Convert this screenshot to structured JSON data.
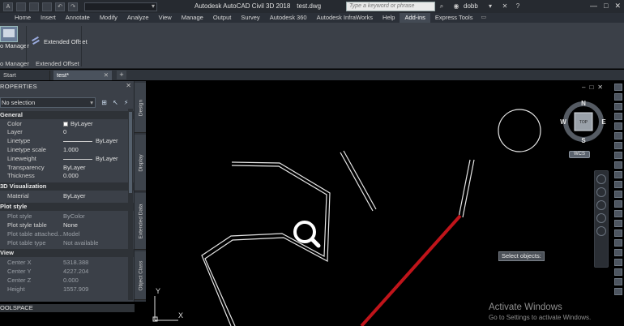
{
  "titlebar": {
    "app_title": "Autodesk AutoCAD Civil 3D 2018",
    "file_name": "test.dwg",
    "search_placeholder": "Type a keyword or phrase",
    "user": "dobb",
    "controls": [
      "—",
      "□",
      "✕"
    ]
  },
  "ribbon_tabs": [
    "Home",
    "Insert",
    "Annotate",
    "Modify",
    "Analyze",
    "View",
    "Manage",
    "Output",
    "Survey",
    "Autodesk 360",
    "Autodesk InfraWorks",
    "Help",
    "Add-ins",
    "Express Tools"
  ],
  "active_tab": "Add-ins",
  "ribbon": {
    "button1_label": "o Manager",
    "button2_label": "Extended Offset",
    "panel1_label": "o Manager",
    "panel2_label": "Extended Offset"
  },
  "doc_tabs": {
    "start_label": "Start",
    "active_label": "test*",
    "plus": "+"
  },
  "properties": {
    "title": "ROPERTIES",
    "selection": "No selection",
    "general_header": "General",
    "general_rows": [
      {
        "k": "Color",
        "v": "ByLayer"
      },
      {
        "k": "Layer",
        "v": "0"
      },
      {
        "k": "Linetype",
        "v": "ByLayer"
      },
      {
        "k": "Linetype scale",
        "v": "1.000"
      },
      {
        "k": "Lineweight",
        "v": "ByLayer"
      },
      {
        "k": "Transparency",
        "v": "ByLayer"
      },
      {
        "k": "Thickness",
        "v": "0.000"
      }
    ],
    "viz_header": "3D Visualization",
    "viz_rows": [
      {
        "k": "Material",
        "v": "ByLayer"
      }
    ],
    "plot_header": "Plot style",
    "plot_rows": [
      {
        "k": "Plot style",
        "v": "ByColor"
      },
      {
        "k": "Plot style table",
        "v": "None"
      },
      {
        "k": "Plot table attached...",
        "v": "Model"
      },
      {
        "k": "Plot table type",
        "v": "Not available"
      }
    ],
    "view_header": "View",
    "view_rows": [
      {
        "k": "Center X",
        "v": "5318.388"
      },
      {
        "k": "Center Y",
        "v": "4227.204"
      },
      {
        "k": "Center Z",
        "v": "0.000"
      },
      {
        "k": "Height",
        "v": "1557.909"
      }
    ],
    "toolspace": "OOLSPACE"
  },
  "side_tabs": [
    "Design",
    "Display",
    "Extended Data",
    "Object Class"
  ],
  "canvas": {
    "compass": {
      "n": "N",
      "s": "S",
      "e": "E",
      "w": "W",
      "top": "TOP"
    },
    "wcs": "WCS",
    "tooltip": "Select objects:",
    "activate_title": "Activate Windows",
    "activate_sub": "Go to Settings to activate Windows.",
    "ucs_y": "Y",
    "ucs_x": "X",
    "vp_controls": [
      "–",
      "□",
      "✕"
    ]
  },
  "colors": {
    "red_line": "#c0141a",
    "drawing_line": "#e6e6e6",
    "accent_tab": "#434a54"
  }
}
